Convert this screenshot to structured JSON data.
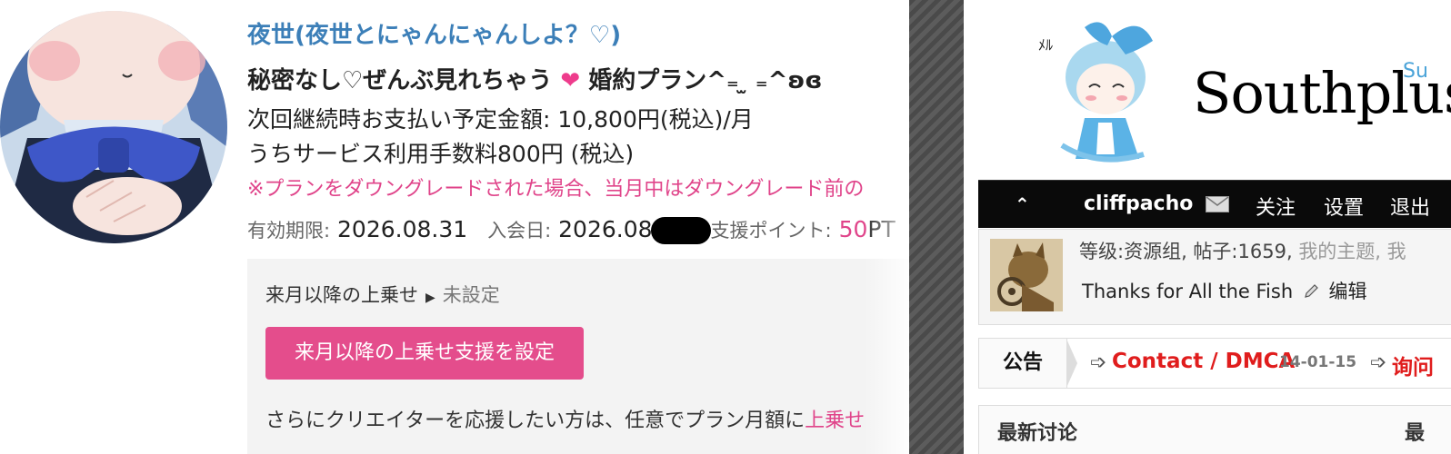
{
  "fanbox": {
    "creator_name": "夜世(夜世とにゃんにゃんしよ？♡)",
    "plan_title_pre": "秘密なし♡ぜんぶ見れちゃう",
    "plan_title_post": "婚約プラン^₌ ̫ ₌^ʚɞ",
    "next_payment": "次回継続時お支払い予定金額: 10,800円(税込)/月",
    "fee": "うちサービス利用手数料800円 (税込)",
    "downgrade_note": "※プランをダウングレードされた場合、当月中はダウングレード前の",
    "expiry_label": "有効期限:",
    "expiry_value": "2026.08.31",
    "joined_label": "入会日:",
    "joined_value": "2026.08",
    "points_label": "支援ポイント:",
    "points_value": "50",
    "points_unit": "PT",
    "boost_label": "来月以降の上乗せ",
    "boost_value": "未設定",
    "boost_button": "来月以降の上乗せ支援を設定",
    "support_text": "さらにクリエイターを応援したい方は、任意でプラン月額に",
    "support_link": "上乗せ"
  },
  "forum": {
    "logo": "Southplus",
    "logo_sup": "Su",
    "nav": {
      "username": "cliffpacho",
      "follow": "关注",
      "settings": "设置",
      "logout": "退出"
    },
    "user": {
      "stats": "等级:资源组, 帖子:1659,",
      "my_topics": "我的主题, 我",
      "signature": "Thanks for All the Fish",
      "edit": "编辑"
    },
    "notice": {
      "label": "公告",
      "item1": "Contact / DMCA",
      "item1_date": "14-01-15",
      "item2": "询问"
    },
    "latest": {
      "title": "最新讨论",
      "right": "最"
    }
  },
  "colors": {
    "link_blue": "#3c7fb8",
    "pink": "#e0448a",
    "button_pink": "#e44d8c",
    "forum_red": "#e01d1d"
  }
}
